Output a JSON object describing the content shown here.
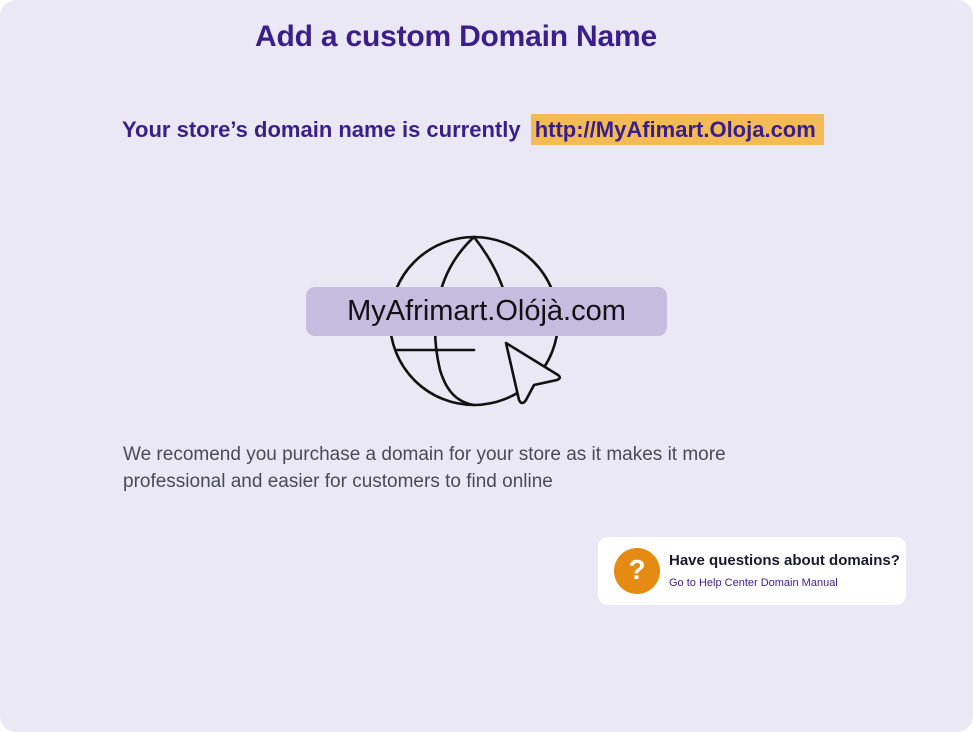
{
  "header": {
    "title": "Add a custom Domain Name"
  },
  "current_domain": {
    "prefix": "Your store’s domain name is currently",
    "url": "http://MyAfimart.Oloja.com",
    "highlight_color": "#f2bb55"
  },
  "illustration": {
    "domain_label": "MyAfrimart.Olójà.com",
    "icons": [
      "globe-icon",
      "cursor-arrow-icon"
    ]
  },
  "recommendation": {
    "text": "We recomend you purchase a domain for your store as it makes it more professional and easier for customers to find online"
  },
  "help": {
    "icon": "question-mark-icon",
    "icon_glyph": "?",
    "title": "Have questions about domains?",
    "link_label": "Go to Help Center Domain Manual",
    "accent_color": "#e58a12"
  },
  "colors": {
    "background": "#eae8f4",
    "brand": "#3a1f8c",
    "pill": "#c4bde0"
  }
}
